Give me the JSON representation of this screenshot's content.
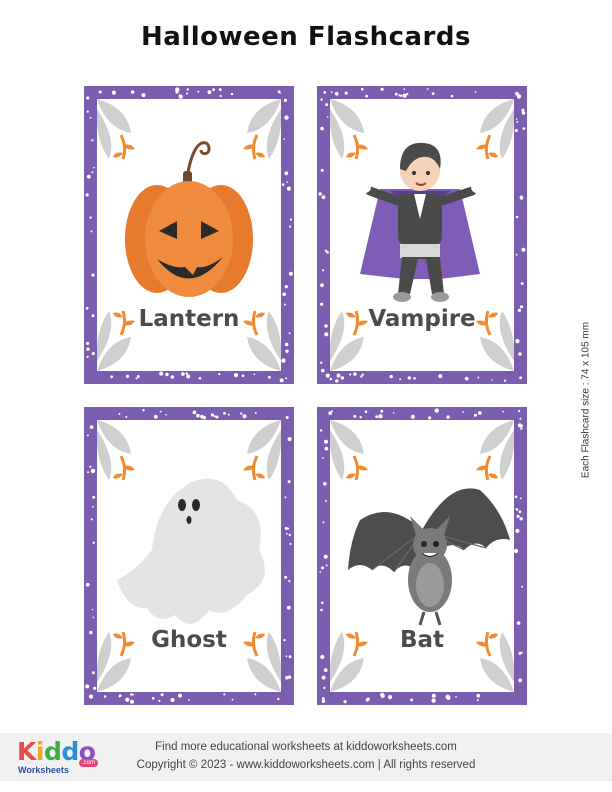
{
  "page": {
    "title": "Halloween Flashcards"
  },
  "cards": [
    {
      "word": "Lantern",
      "picture": "jack-o-lantern-pumpkin"
    },
    {
      "word": "Vampire",
      "picture": "vampire-boy"
    },
    {
      "word": "Ghost",
      "picture": "ghost"
    },
    {
      "word": "Bat",
      "picture": "bat"
    }
  ],
  "side_note": "Each Flashcard size : 74 x 105 mm",
  "footer": {
    "logo_text": "Kiddo",
    "logo_sub": "Worksheets",
    "logo_badge": ".com",
    "line1": "Find more educational worksheets at kiddoworksheets.com",
    "line2": "Copyright © 2023 - www.kiddoworksheets.com  |  All rights reserved"
  },
  "colors": {
    "card_border": "#7b5db0",
    "leaf_orange": "#f28b30",
    "leaf_gray": "#cfcfcf",
    "word_text": "#4b4b4b",
    "pumpkin": "#f08a3c",
    "cape_purple": "#7f5cb8"
  }
}
